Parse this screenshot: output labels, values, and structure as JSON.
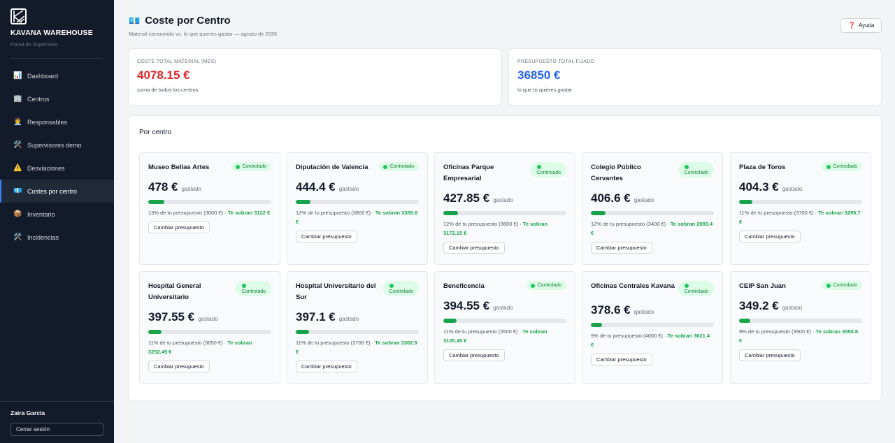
{
  "brand": {
    "name": "KAVANA WAREHOUSE",
    "subtitle": "Panel de Supervisor"
  },
  "nav": [
    {
      "label": "Dashboard",
      "icon": "chart-icon",
      "glyph": "📊"
    },
    {
      "label": "Centros",
      "icon": "building-icon",
      "glyph": "🏢"
    },
    {
      "label": "Responsables",
      "icon": "person-icon",
      "glyph": "🧑‍💼"
    },
    {
      "label": "Supervisores demo",
      "icon": "tools-icon",
      "glyph": "🛠️"
    },
    {
      "label": "Desviaciones",
      "icon": "warning-icon",
      "glyph": "⚠️"
    },
    {
      "label": "Costes por centro",
      "icon": "money-icon",
      "glyph": "💶",
      "active": true
    },
    {
      "label": "Inventario",
      "icon": "box-icon",
      "glyph": "📦"
    },
    {
      "label": "Incidencias",
      "icon": "tools-icon",
      "glyph": "🛠️"
    }
  ],
  "user": {
    "name": "Zaira García",
    "logout": "Cerrar sesión"
  },
  "header": {
    "icon": "money-icon",
    "glyph": "💶",
    "title": "Coste por Centro",
    "subtitle": "Material consumido vs. lo que quieres gastar — agosto de 2026",
    "help": "Ayuda",
    "help_glyph": "❓"
  },
  "stats": {
    "total_cost": {
      "label": "Coste total material (mes)",
      "value": "4078.15 €",
      "note": "suma de todos los centros"
    },
    "total_budget": {
      "label": "Presupuesto total fijado",
      "value": "36850 €",
      "note": "lo que tú quieres gastar"
    }
  },
  "panel": {
    "title": "Por centro"
  },
  "card_labels": {
    "spent": "gastado",
    "status": "Controlado",
    "change": "Cambiar presupuesto",
    "sobran": "Te sobran"
  },
  "centers": [
    {
      "name": "Museo Bellas Artes",
      "amount": "478 €",
      "pct": 13,
      "desc": "13% de tu presupuesto (3600 €) ·",
      "remaining": "3122 €",
      "status": "Controlado",
      "wrap_badge": false
    },
    {
      "name": "Diputación de Valencia",
      "amount": "444.4 €",
      "pct": 12,
      "desc": "12% de tu presupuesto (3800 €) ·",
      "remaining": "3355.6 €",
      "status": "Controlado",
      "wrap_badge": false
    },
    {
      "name": "Oficinas Parque Empresarial",
      "amount": "427.85 €",
      "pct": 12,
      "desc": "12% de tu presupuesto (3600 €) ·",
      "remaining": "3172.15 €",
      "status": "Controlado",
      "wrap_badge": true
    },
    {
      "name": "Colegio Público Cervantes",
      "amount": "406.6 €",
      "pct": 12,
      "desc": "12% de tu presupuesto (3400 €) ·",
      "remaining": "2993.4 €",
      "status": "Controlado",
      "wrap_badge": true
    },
    {
      "name": "Plaza de Toros",
      "amount": "404.3 €",
      "pct": 11,
      "desc": "11% de tu presupuesto (3700 €) ·",
      "remaining": "3295.7 €",
      "status": "Controlado",
      "wrap_badge": false
    },
    {
      "name": "Hospital General Universitario",
      "amount": "397.55 €",
      "pct": 11,
      "desc": "11% de tu presupuesto (3650 €) ·",
      "remaining": "3252.45 €",
      "status": "Controlado",
      "wrap_badge": true
    },
    {
      "name": "Hospital Universitario del Sur",
      "amount": "397.1 €",
      "pct": 11,
      "desc": "11% de tu presupuesto (3700 €) ·",
      "remaining": "3302.9 €",
      "status": "Controlado",
      "wrap_badge": true
    },
    {
      "name": "Beneficencia",
      "amount": "394.55 €",
      "pct": 11,
      "desc": "11% de tu presupuesto (3500 €) ·",
      "remaining": "3105.45 €",
      "status": "Controlado",
      "wrap_badge": false
    },
    {
      "name": "Oficinas Centrales Kavana",
      "amount": "378.6 €",
      "pct": 9,
      "desc": "9% de tu presupuesto (4000 €) ·",
      "remaining": "3621.4 €",
      "status": "Controlado",
      "wrap_badge": true
    },
    {
      "name": "CEIP San Juan",
      "amount": "349.2 €",
      "pct": 9,
      "desc": "9% de tu presupuesto (3900 €) ·",
      "remaining": "3550.8 €",
      "status": "Controlado",
      "wrap_badge": false
    }
  ]
}
